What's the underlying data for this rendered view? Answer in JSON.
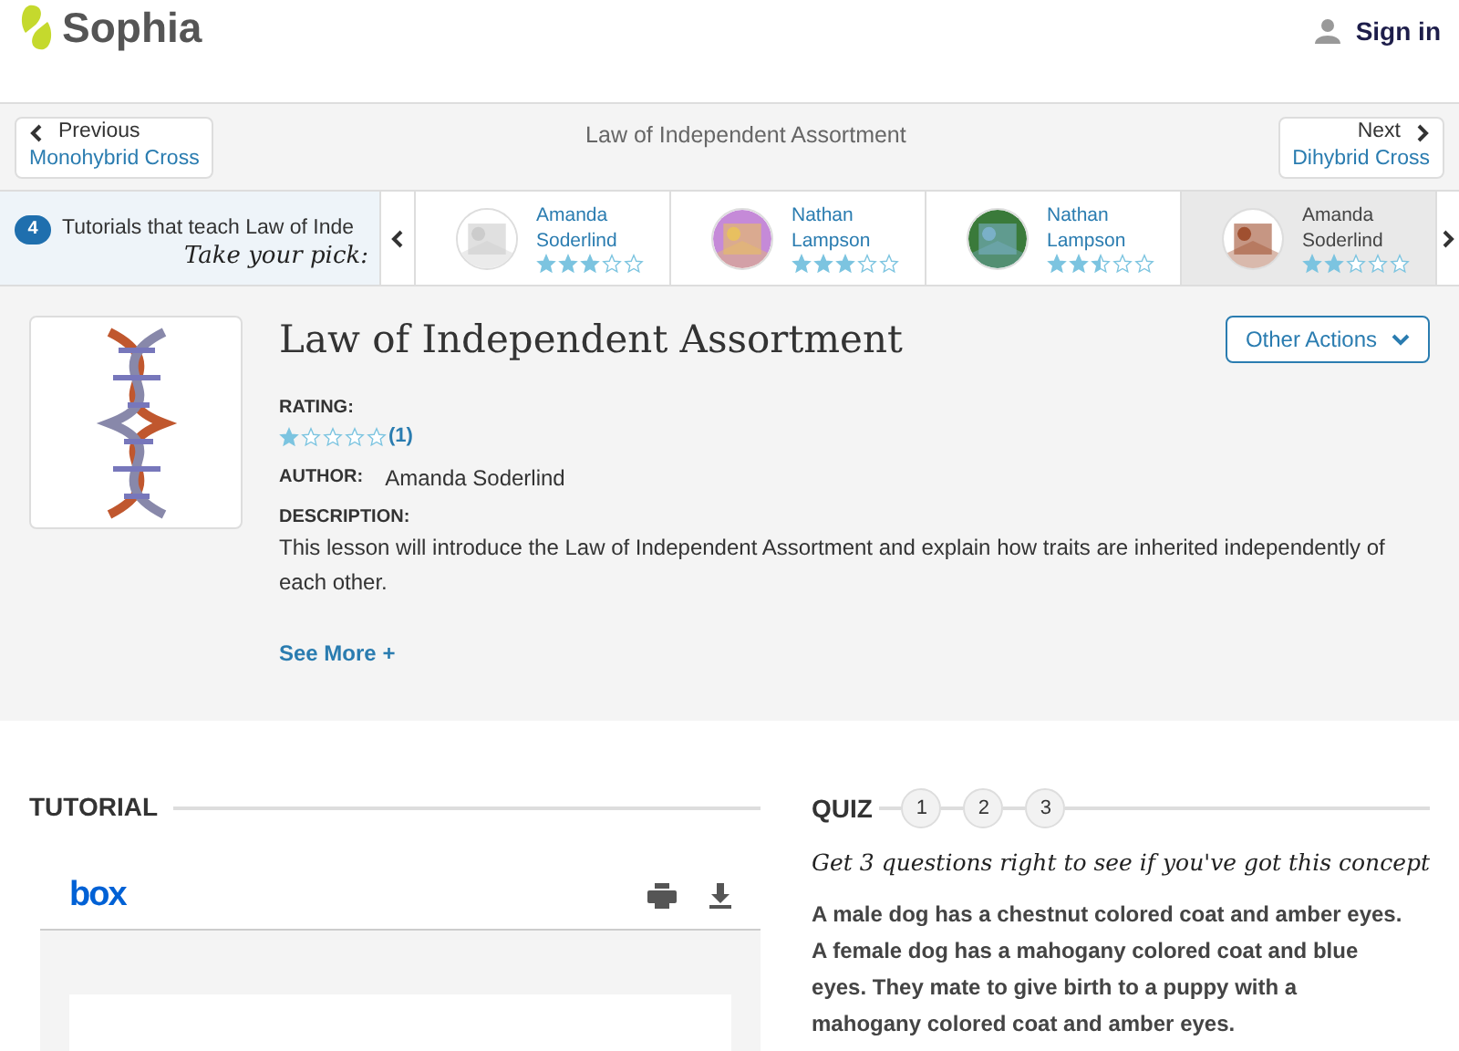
{
  "header": {
    "logo": "Sophia",
    "sign_in": "Sign in"
  },
  "nav": {
    "previous": {
      "label": "Previous",
      "title": "Monohybrid Cross"
    },
    "current_title": "Law of Independent Assortment",
    "next": {
      "label": "Next",
      "title": "Dihybrid Cross"
    }
  },
  "tutorials": {
    "count": "4",
    "label": "Tutorials that teach Law of Inde",
    "tagline": "Take your pick:",
    "items": [
      {
        "author_first": "Amanda",
        "author_last": "Soderlind",
        "stars": 3,
        "selected": false
      },
      {
        "author_first": "Nathan",
        "author_last": "Lampson",
        "stars": 3,
        "selected": false
      },
      {
        "author_first": "Nathan",
        "author_last": "Lampson",
        "stars": 2.5,
        "selected": false
      },
      {
        "author_first": "Amanda",
        "author_last": "Soderlind",
        "stars": 2,
        "selected": true
      }
    ]
  },
  "lesson": {
    "title": "Law of Independent Assortment",
    "actions_button": "Other Actions",
    "rating_label": "RATING:",
    "stars": 1,
    "rating_count": "(1)",
    "author_label": "AUTHOR:",
    "author": "Amanda Soderlind",
    "description_label": "DESCRIPTION:",
    "description": "This lesson will introduce the Law of Independent Assortment and explain how traits are inherited independently of each other.",
    "see_more": "See More +"
  },
  "tutorial": {
    "heading": "TUTORIAL",
    "viewer_logo": "box"
  },
  "quiz": {
    "heading": "QUIZ",
    "steps": [
      "1",
      "2",
      "3"
    ],
    "tagline": "Get 3 questions right to see if you've got this concept",
    "question": "A male dog has a chestnut colored coat and amber eyes. A female dog has a mahogany colored coat and blue eyes. They mate to give birth to a puppy with a mahogany colored coat and amber eyes."
  }
}
